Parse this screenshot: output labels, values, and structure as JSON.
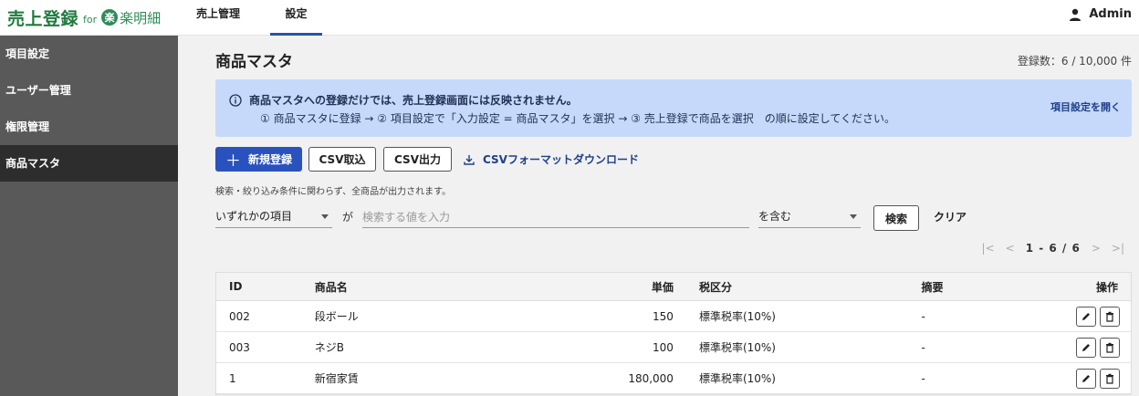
{
  "brand": {
    "main": "売上登録",
    "for": "for",
    "badge": "楽",
    "sub": "楽明細"
  },
  "nav": {
    "tabs": [
      {
        "label": "売上管理"
      },
      {
        "label": "設定"
      }
    ]
  },
  "user": {
    "name": "Admin"
  },
  "sidebar": {
    "items": [
      {
        "label": "項目設定"
      },
      {
        "label": "ユーザー管理"
      },
      {
        "label": "権限管理"
      },
      {
        "label": "商品マスタ"
      }
    ]
  },
  "page": {
    "title": "商品マスタ",
    "count": "登録数：6 / 10,000 件"
  },
  "info": {
    "title": "商品マスタへの登録だけでは、売上登録画面には反映されません。",
    "body": "① 商品マスタに登録 → ② 項目設定で「入力設定 = 商品マスタ」を選択 → ③ 売上登録で商品を選択　の順に設定してください。",
    "link": "項目設定を開く"
  },
  "actions": {
    "new": "新規登録",
    "import": "CSV取込",
    "export": "CSV出力",
    "download": "CSVフォーマットダウンロード",
    "note": "検索・絞り込み条件に関わらず、全商品が出力されます。"
  },
  "search": {
    "field": "いずれかの項目",
    "ga": "が",
    "placeholder": "検索する値を入力",
    "value": "",
    "op": "を含む",
    "button": "検索",
    "clear": "クリア"
  },
  "pager": {
    "range": "1 - 6 / 6"
  },
  "table": {
    "headers": {
      "id": "ID",
      "name": "商品名",
      "price": "単価",
      "tax": "税区分",
      "memo": "摘要",
      "ops": "操作"
    },
    "rows": [
      {
        "id": "002",
        "name": "段ボール",
        "price": "150",
        "tax": "標準税率(10%)",
        "memo": "-"
      },
      {
        "id": "003",
        "name": "ネジB",
        "price": "100",
        "tax": "標準税率(10%)",
        "memo": "-"
      },
      {
        "id": "1",
        "name": "新宿家賃",
        "price": "180,000",
        "tax": "標準税率(10%)",
        "memo": "-"
      }
    ]
  },
  "colors": {
    "accent": "#2a52be",
    "brand": "#1e7a3c",
    "sidebar": "#595959",
    "sidebar_active": "#2d2d2d",
    "info_bg": "#c6d9fb"
  }
}
